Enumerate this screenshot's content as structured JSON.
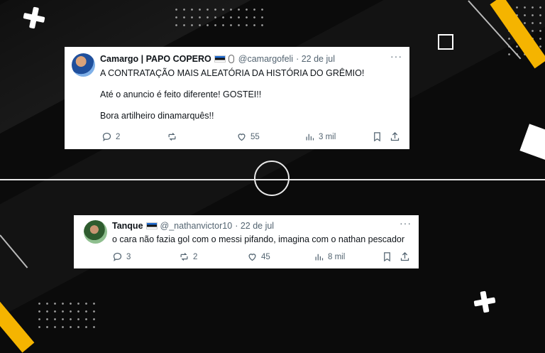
{
  "colors": {
    "background": "#0b0b0b",
    "accent": "#f5b400",
    "card": "#ffffff",
    "muted_text": "#536471"
  },
  "tweets": [
    {
      "name": "Camargo | PAPO COPERO",
      "handle": "@camargofeli",
      "date": "· 22 de jul",
      "more": "···",
      "lines": [
        "A CONTRATAÇÃO MAIS ALEATÓRIA DA HISTÓRIA DO GRÊMIO!",
        "Até o anuncio é feito diferente! GOSTEI!!",
        "Bora artilheiro dinamarquês!!"
      ],
      "replies": "2",
      "retweets": "",
      "likes": "55",
      "views": "3 mil"
    },
    {
      "name": "Tanque",
      "handle": "@_nathanvictor10",
      "date": "· 22 de jul",
      "more": "···",
      "lines": [
        "o cara não fazia gol com o messi pifando, imagina com o nathan pescador"
      ],
      "replies": "3",
      "retweets": "2",
      "likes": "45",
      "views": "8 mil"
    }
  ]
}
